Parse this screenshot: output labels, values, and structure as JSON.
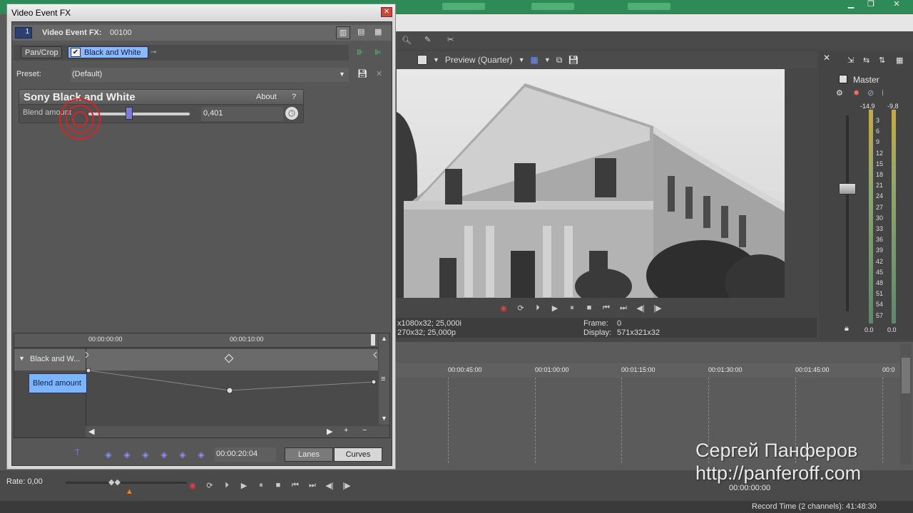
{
  "fx_window": {
    "title": "Video Event FX",
    "close_symbol": "✕",
    "header_label": "Video Event FX:",
    "header_value": "00100",
    "header_badge": "1",
    "chain": {
      "pan_crop": "Pan/Crop",
      "black_white": "Black and White"
    },
    "preset_label": "Preset:",
    "preset_value": "(Default)",
    "plugin_title": "Sony Black and White",
    "about_label": "About",
    "help_label": "?",
    "param_label": "Blend amount",
    "param_value": "0,401",
    "param_fraction": 0.401,
    "keyframes": {
      "ruler_start": "00:00:00:00",
      "ruler_mid": "00:00:10:00",
      "track_label": "Black and W...",
      "lane_label": "Blend amount"
    },
    "time_value": "00:00:20:04",
    "lanes_label": "Lanes",
    "curves_label": "Curves"
  },
  "preview": {
    "mode": "Preview (Quarter)",
    "info_line1": "x1080x32; 25,000i",
    "info_line2": "270x32; 25,000p",
    "frame_label": "Frame:",
    "frame_value": "0",
    "display_label": "Display:",
    "display_value": "571x321x32"
  },
  "mixer": {
    "title": "Master",
    "peak_left": "-14,9",
    "peak_right": "-9,8",
    "bottom_left": "0.0",
    "bottom_right": "0.0",
    "scale": [
      "3",
      "6",
      "9",
      "12",
      "15",
      "18",
      "21",
      "24",
      "27",
      "30",
      "33",
      "36",
      "39",
      "42",
      "45",
      "48",
      "51",
      "54",
      "57"
    ]
  },
  "timeline": {
    "ticks": [
      "00:00:45:00",
      "00:01:00:00",
      "00:01:15:00",
      "00:01:30:00",
      "00:01:45:00",
      "00:0"
    ]
  },
  "bottom": {
    "rate": "Rate: 0,00",
    "time": "00:00:00:00",
    "record_time": "Record Time (2 channels): 41:48:30"
  },
  "watermark": {
    "name": "Сергей Панферов",
    "url": "http://panferoff.com"
  },
  "colors": {
    "accent_blue": "#8cb8ff",
    "app_green": "#2e8b57",
    "slider_thumb": "#7b7bd8",
    "keyframe_diamond": "#8a8cff"
  }
}
